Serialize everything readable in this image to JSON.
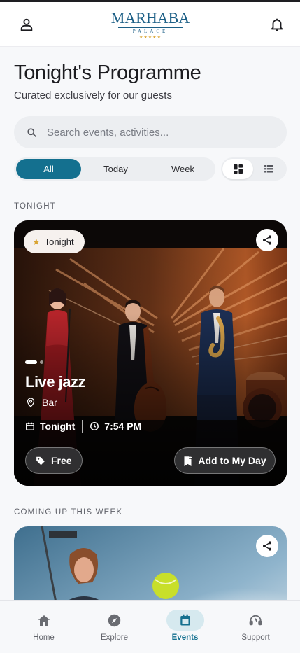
{
  "header": {
    "logo_main": "MARHABA",
    "logo_sub": "PALACE",
    "logo_stars": "★★★★★"
  },
  "page": {
    "title": "Tonight's Programme",
    "subtitle": "Curated exclusively for our guests"
  },
  "search": {
    "placeholder": "Search events, activities...",
    "value": ""
  },
  "filters": {
    "items": [
      {
        "label": "All",
        "active": true
      },
      {
        "label": "Today",
        "active": false
      },
      {
        "label": "Week",
        "active": false
      }
    ],
    "view_mode": "grid"
  },
  "sections": {
    "tonight": "TONIGHT",
    "week": "COMING UP THIS WEEK"
  },
  "featured_event": {
    "badge": "Tonight",
    "title": "Live jazz",
    "location": "Bar",
    "day": "Tonight",
    "time": "7:54 PM",
    "price": "Free",
    "add_label": "Add to My Day",
    "slide_count": 2,
    "active_slide": 1
  },
  "bottom_nav": {
    "items": [
      {
        "label": "Home",
        "icon": "home-icon",
        "active": false
      },
      {
        "label": "Explore",
        "icon": "compass-icon",
        "active": false
      },
      {
        "label": "Events",
        "icon": "calendar-icon",
        "active": true
      },
      {
        "label": "Support",
        "icon": "headset-icon",
        "active": false
      }
    ]
  },
  "colors": {
    "accent": "#14708f",
    "brand": "#1c5f86",
    "gold": "#d9a534",
    "nav_active_bg": "#d6e9ef"
  }
}
